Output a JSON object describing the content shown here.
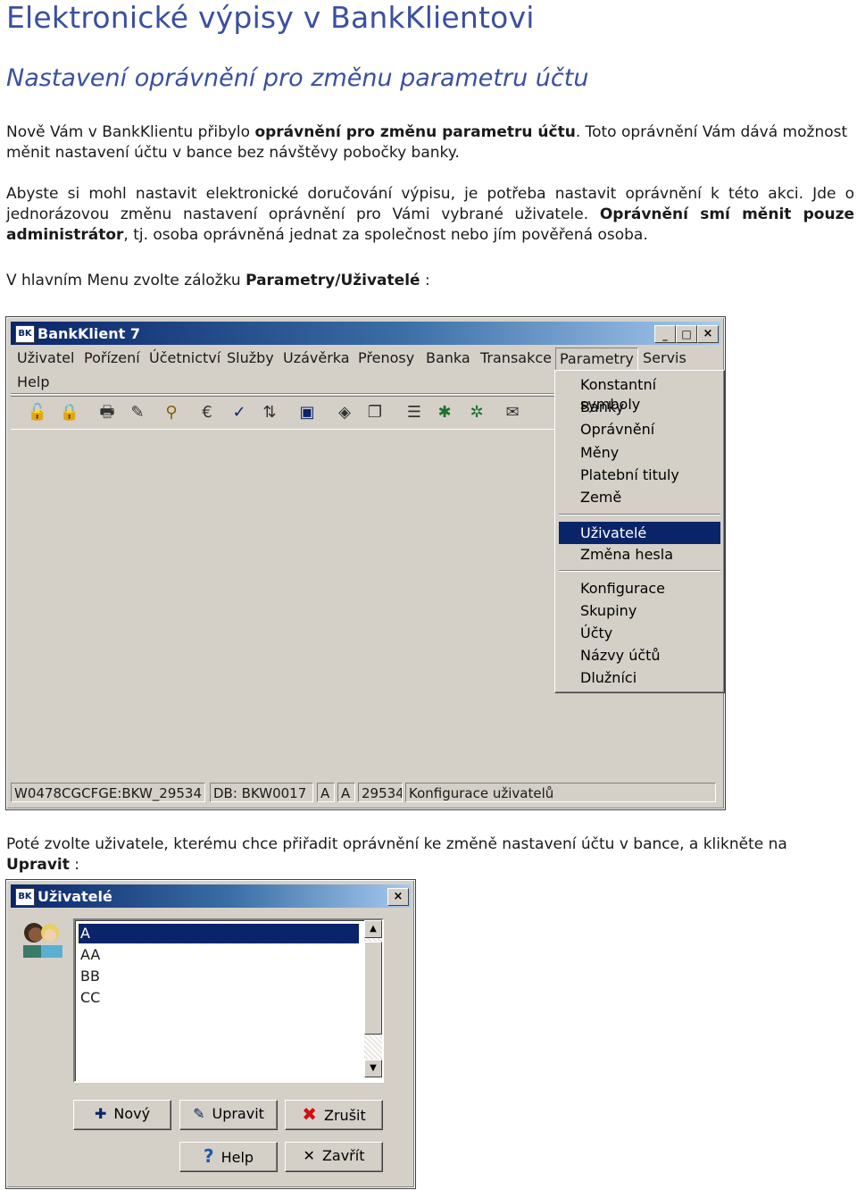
{
  "doc": {
    "title": "Elektronické výpisy v BankKlientovi",
    "subtitle": "Nastavení oprávnění pro změnu parametru účtu",
    "p1_a": "Nově Vám v BankKlientu přibylo ",
    "p1_b": "oprávnění pro změnu parametru účtu",
    "p1_c": ". Toto oprávnění Vám dává možnost měnit nastavení účtu v bance bez návštěvy pobočky banky.",
    "p2_a": "Abyste si mohl nastavit elektronické doručování výpisu, je potřeba nastavit oprávnění k této akci. Jde o jednorázovou změnu nastavení oprávnění pro Vámi vybrané uživatele. ",
    "p2_b": "Oprávnění smí měnit pouze administrátor",
    "p2_c": ", tj. osoba oprávněná jednat za společnost nebo jím pověřená osoba.",
    "p3_a": "V hlavním Menu zvolte záložku ",
    "p3_b": "Parametry/Uživatelé",
    "p3_c": " :",
    "p4_a": "Poté zvolte uživatele, kterému chce přiřadit oprávnění ke změně nastavení účtu v bance, a klikněte na ",
    "p4_b": "Upravit",
    "p4_c": " :"
  },
  "bankklient": {
    "logo": "BK",
    "title": "BankKlient 7",
    "menu": [
      "Uživatel",
      "Pořízení",
      "Účetnictví",
      "Služby",
      "Uzávěrka",
      "Přenosy",
      "Banka",
      "Transakce",
      "Parametry",
      "Servis",
      "Help"
    ],
    "dropdown": {
      "group1": [
        "Konstantní symboly",
        "Banky",
        "Oprávnění",
        "Měny",
        "Platební tituly",
        "Země"
      ],
      "group2": [
        "Uživatelé",
        "Změna hesla"
      ],
      "group3": [
        "Konfigurace",
        "Skupiny",
        "Účty",
        "Názvy účtů",
        "Dlužníci"
      ],
      "selected": "Uživatelé"
    },
    "toolbar_icons": [
      "lock-open-icon",
      "lock-icon",
      "printer-icon",
      "edit-icon",
      "stamp-icon",
      "currency-icon",
      "check-icon",
      "transfer-icon",
      "save-icon",
      "network-icon",
      "copy-icon",
      "document-icon",
      "gear-icon",
      "gear-alt-icon",
      "mail-icon"
    ],
    "status": [
      "W0478CGCFGE:BKW_29534",
      "DB: BKW0017",
      "A",
      "A",
      "29534",
      "Konfigurace uživatelů"
    ]
  },
  "users_dialog": {
    "logo": "BK",
    "title": "Uživatelé",
    "users": [
      "A",
      "AA",
      "BB",
      "CC"
    ],
    "selected": "A",
    "buttons": {
      "new": "Nový",
      "edit": "Upravit",
      "delete": "Zrušit",
      "help": "Help",
      "close": "Zavřít"
    }
  }
}
